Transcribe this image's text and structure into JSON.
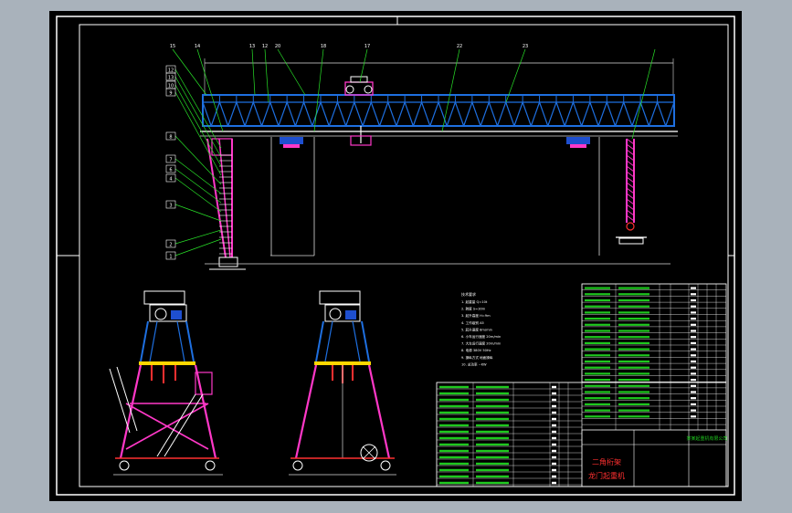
{
  "window": {
    "title": ""
  },
  "colors": {
    "canvas_bg": "#000000",
    "window_bg": "#a9b2bb",
    "frame": "#ffffff",
    "truss": "#1e6fe0",
    "leg": "#ff38c8",
    "leader": "#28e028",
    "dimension": "#e0e0e0",
    "wheel": "#ff3030",
    "table_text": "#1ec81e",
    "hook": "#ff4040"
  },
  "title_block": {
    "title_line1": "二角桁架",
    "title_line2": "龙门起重机",
    "company": "某某起重机有限公司"
  },
  "diagram": {
    "views": [
      "front-elevation",
      "side-view-left",
      "side-view-right"
    ],
    "balloon_numbers_left": [
      "12",
      "13",
      "10",
      "9",
      "8",
      "7",
      "6",
      "4",
      "3",
      "2",
      "1"
    ],
    "balloon_numbers_top": [
      "15",
      "14",
      "13",
      "12",
      "20",
      "18",
      "17",
      "22",
      "23"
    ],
    "tech_notes_heading": "技术要求",
    "tech_notes": [
      "1. 起重量 Q=10t",
      "2. 跨度 S=30m",
      "3. 起升高度 H=9m",
      "4. 工作级别 A5",
      "5. 起升速度 8m/min",
      "6. 小车运行速度 20m/min",
      "7. 大车运行速度 20m/min",
      "8. 电源 380V 50Hz",
      "9. 操纵方式 地面操纵",
      "10. 总功率 ~KW"
    ]
  },
  "parts_table": {
    "columns": [
      "序号",
      "代号",
      "名称",
      "数量",
      "材料",
      "单重",
      "总重",
      "备注"
    ],
    "row_count_upper": 24,
    "row_count_lower": 16
  }
}
